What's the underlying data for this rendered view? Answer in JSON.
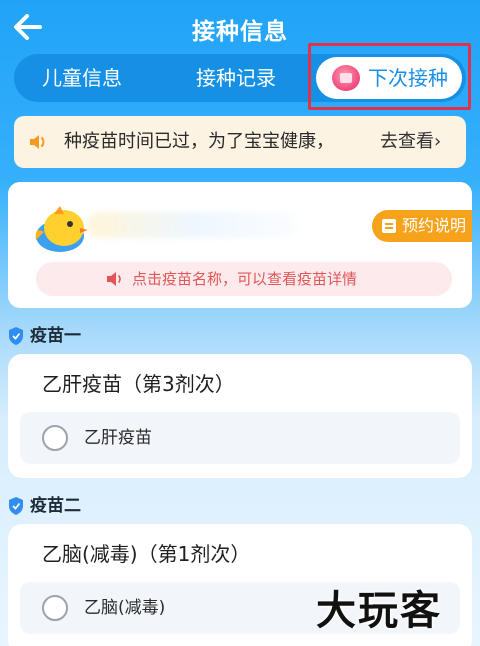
{
  "header": {
    "title": "接种信息",
    "back_icon": "arrow-left-icon"
  },
  "tabs": {
    "items": [
      "儿童信息",
      "接种记录"
    ],
    "active": "下次接种",
    "active_icon": "calendar-icon"
  },
  "notice": {
    "text": "种疫苗时间已过，为了宝宝健康，",
    "link": "去查看",
    "chevron": "›"
  },
  "profile": {
    "appointment_label": "预约说明",
    "hint": "点击疫苗名称，可以查看疫苗详情"
  },
  "sections": [
    {
      "label": "疫苗一",
      "vaccine": "乙肝疫苗（第3剂次）",
      "option": "乙肝疫苗"
    },
    {
      "label": "疫苗二",
      "vaccine": "乙脑(减毒)（第1剂次）",
      "option": "乙脑(减毒)"
    }
  ],
  "watermark": "大玩客",
  "colors": {
    "primary": "#21a3f7",
    "highlight": "#e2314d",
    "warning": "#f7a21b",
    "hint": "#e15757"
  }
}
